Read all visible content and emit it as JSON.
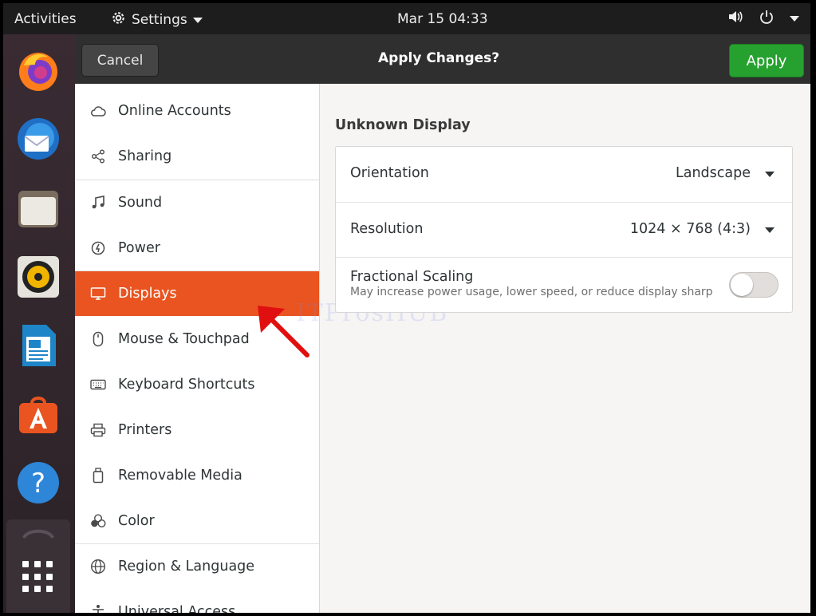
{
  "topbar": {
    "activities": "Activities",
    "app_menu": "Settings",
    "clock": "Mar 15  04:33"
  },
  "dock": {
    "apps": [
      "firefox-icon",
      "thunderbird-icon",
      "files-icon",
      "rhythmbox-icon",
      "libreoffice-writer-icon",
      "software-icon",
      "help-icon"
    ]
  },
  "header": {
    "cancel_label": "Cancel",
    "title": "Apply Changes?",
    "apply_label": "Apply"
  },
  "sidebar": {
    "items": [
      {
        "label": "Online Accounts",
        "icon": "cloud-icon"
      },
      {
        "label": "Sharing",
        "icon": "share-icon"
      },
      {
        "label": "Sound",
        "icon": "music-note-icon"
      },
      {
        "label": "Power",
        "icon": "power-icon"
      },
      {
        "label": "Displays",
        "icon": "display-icon",
        "active": true
      },
      {
        "label": "Mouse & Touchpad",
        "icon": "mouse-icon"
      },
      {
        "label": "Keyboard Shortcuts",
        "icon": "keyboard-icon"
      },
      {
        "label": "Printers",
        "icon": "printer-icon"
      },
      {
        "label": "Removable Media",
        "icon": "usb-icon"
      },
      {
        "label": "Color",
        "icon": "color-icon"
      },
      {
        "label": "Region & Language",
        "icon": "globe-icon"
      },
      {
        "label": "Universal Access",
        "icon": "accessibility-icon"
      }
    ]
  },
  "display": {
    "name": "Unknown Display",
    "orientation_label": "Orientation",
    "orientation_value": "Landscape",
    "resolution_label": "Resolution",
    "resolution_value": "1024 × 768 (4:3)",
    "scaling_label": "Fractional Scaling",
    "scaling_sublabel": "May increase power usage, lower speed, or reduce display sharp…",
    "scaling_enabled": false
  },
  "watermark": "ITProsHUB",
  "colors": {
    "accent": "#e95420",
    "apply": "#26a12f",
    "annotation": "#e01010"
  }
}
